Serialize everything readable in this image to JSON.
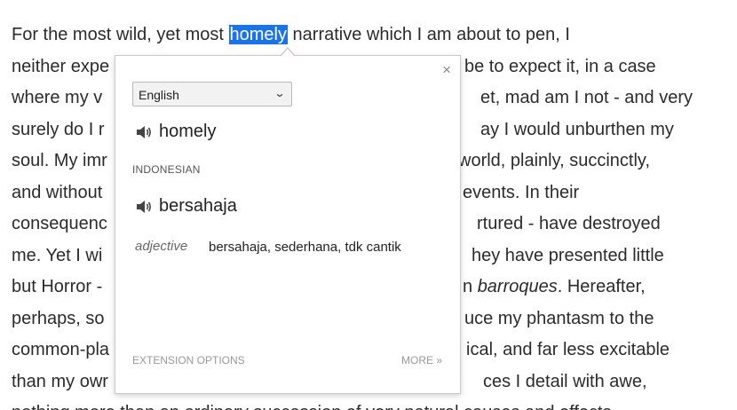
{
  "article": {
    "line1_before": "For the most wild, yet most ",
    "line1_highlight": "homely",
    "line1_after": " narrative which I am about to pen, I",
    "line2_left": "neither expe",
    "line2_right": "be to expect it, in a case",
    "line3_left": "where my v",
    "line3_right": "et, mad am I not - and very",
    "line4_left": "surely do I r",
    "line4_right": "ay I would unburthen my",
    "line5_left": "soul. My imr",
    "line5_right": "world, plainly, succinctly,",
    "line6_left": "and without",
    "line6_right": "events. In their",
    "line7_left": "consequenc",
    "line7_right": "rtured - have destroyed",
    "line8_left": "me. Yet I wi",
    "line8_right": "hey have presented little",
    "line9_left": "but Horror -",
    "line9_right_before": "n ",
    "line9_right_italic": "barroques",
    "line9_right_after": ". Hereafter,",
    "line10_left": "perhaps, so",
    "line10_right": "uce my phantasm to the",
    "line11_left": "common-pla",
    "line11_right": "ical, and far less excitable",
    "line12_left": "than my owr",
    "line12_right": "ces I detail with awe,",
    "line13": "nothing more than an ordinary succession of very natural causes and effects."
  },
  "popup": {
    "close_label": "×",
    "language_selected": "English",
    "source_word": "homely",
    "target_language_label": "INDONESIAN",
    "translated_word": "bersahaja",
    "part_of_speech": "adjective",
    "definitions": "bersahaja, sederhana, tdk cantik",
    "extension_options_label": "EXTENSION OPTIONS",
    "more_label": "MORE »"
  },
  "colors": {
    "highlight": "#1a73e8",
    "body_text": "#2b2b2b",
    "muted": "#999999"
  },
  "icons": {
    "speaker": "speaker-icon",
    "close": "close-icon",
    "dropdown": "chevron-down-icon"
  }
}
